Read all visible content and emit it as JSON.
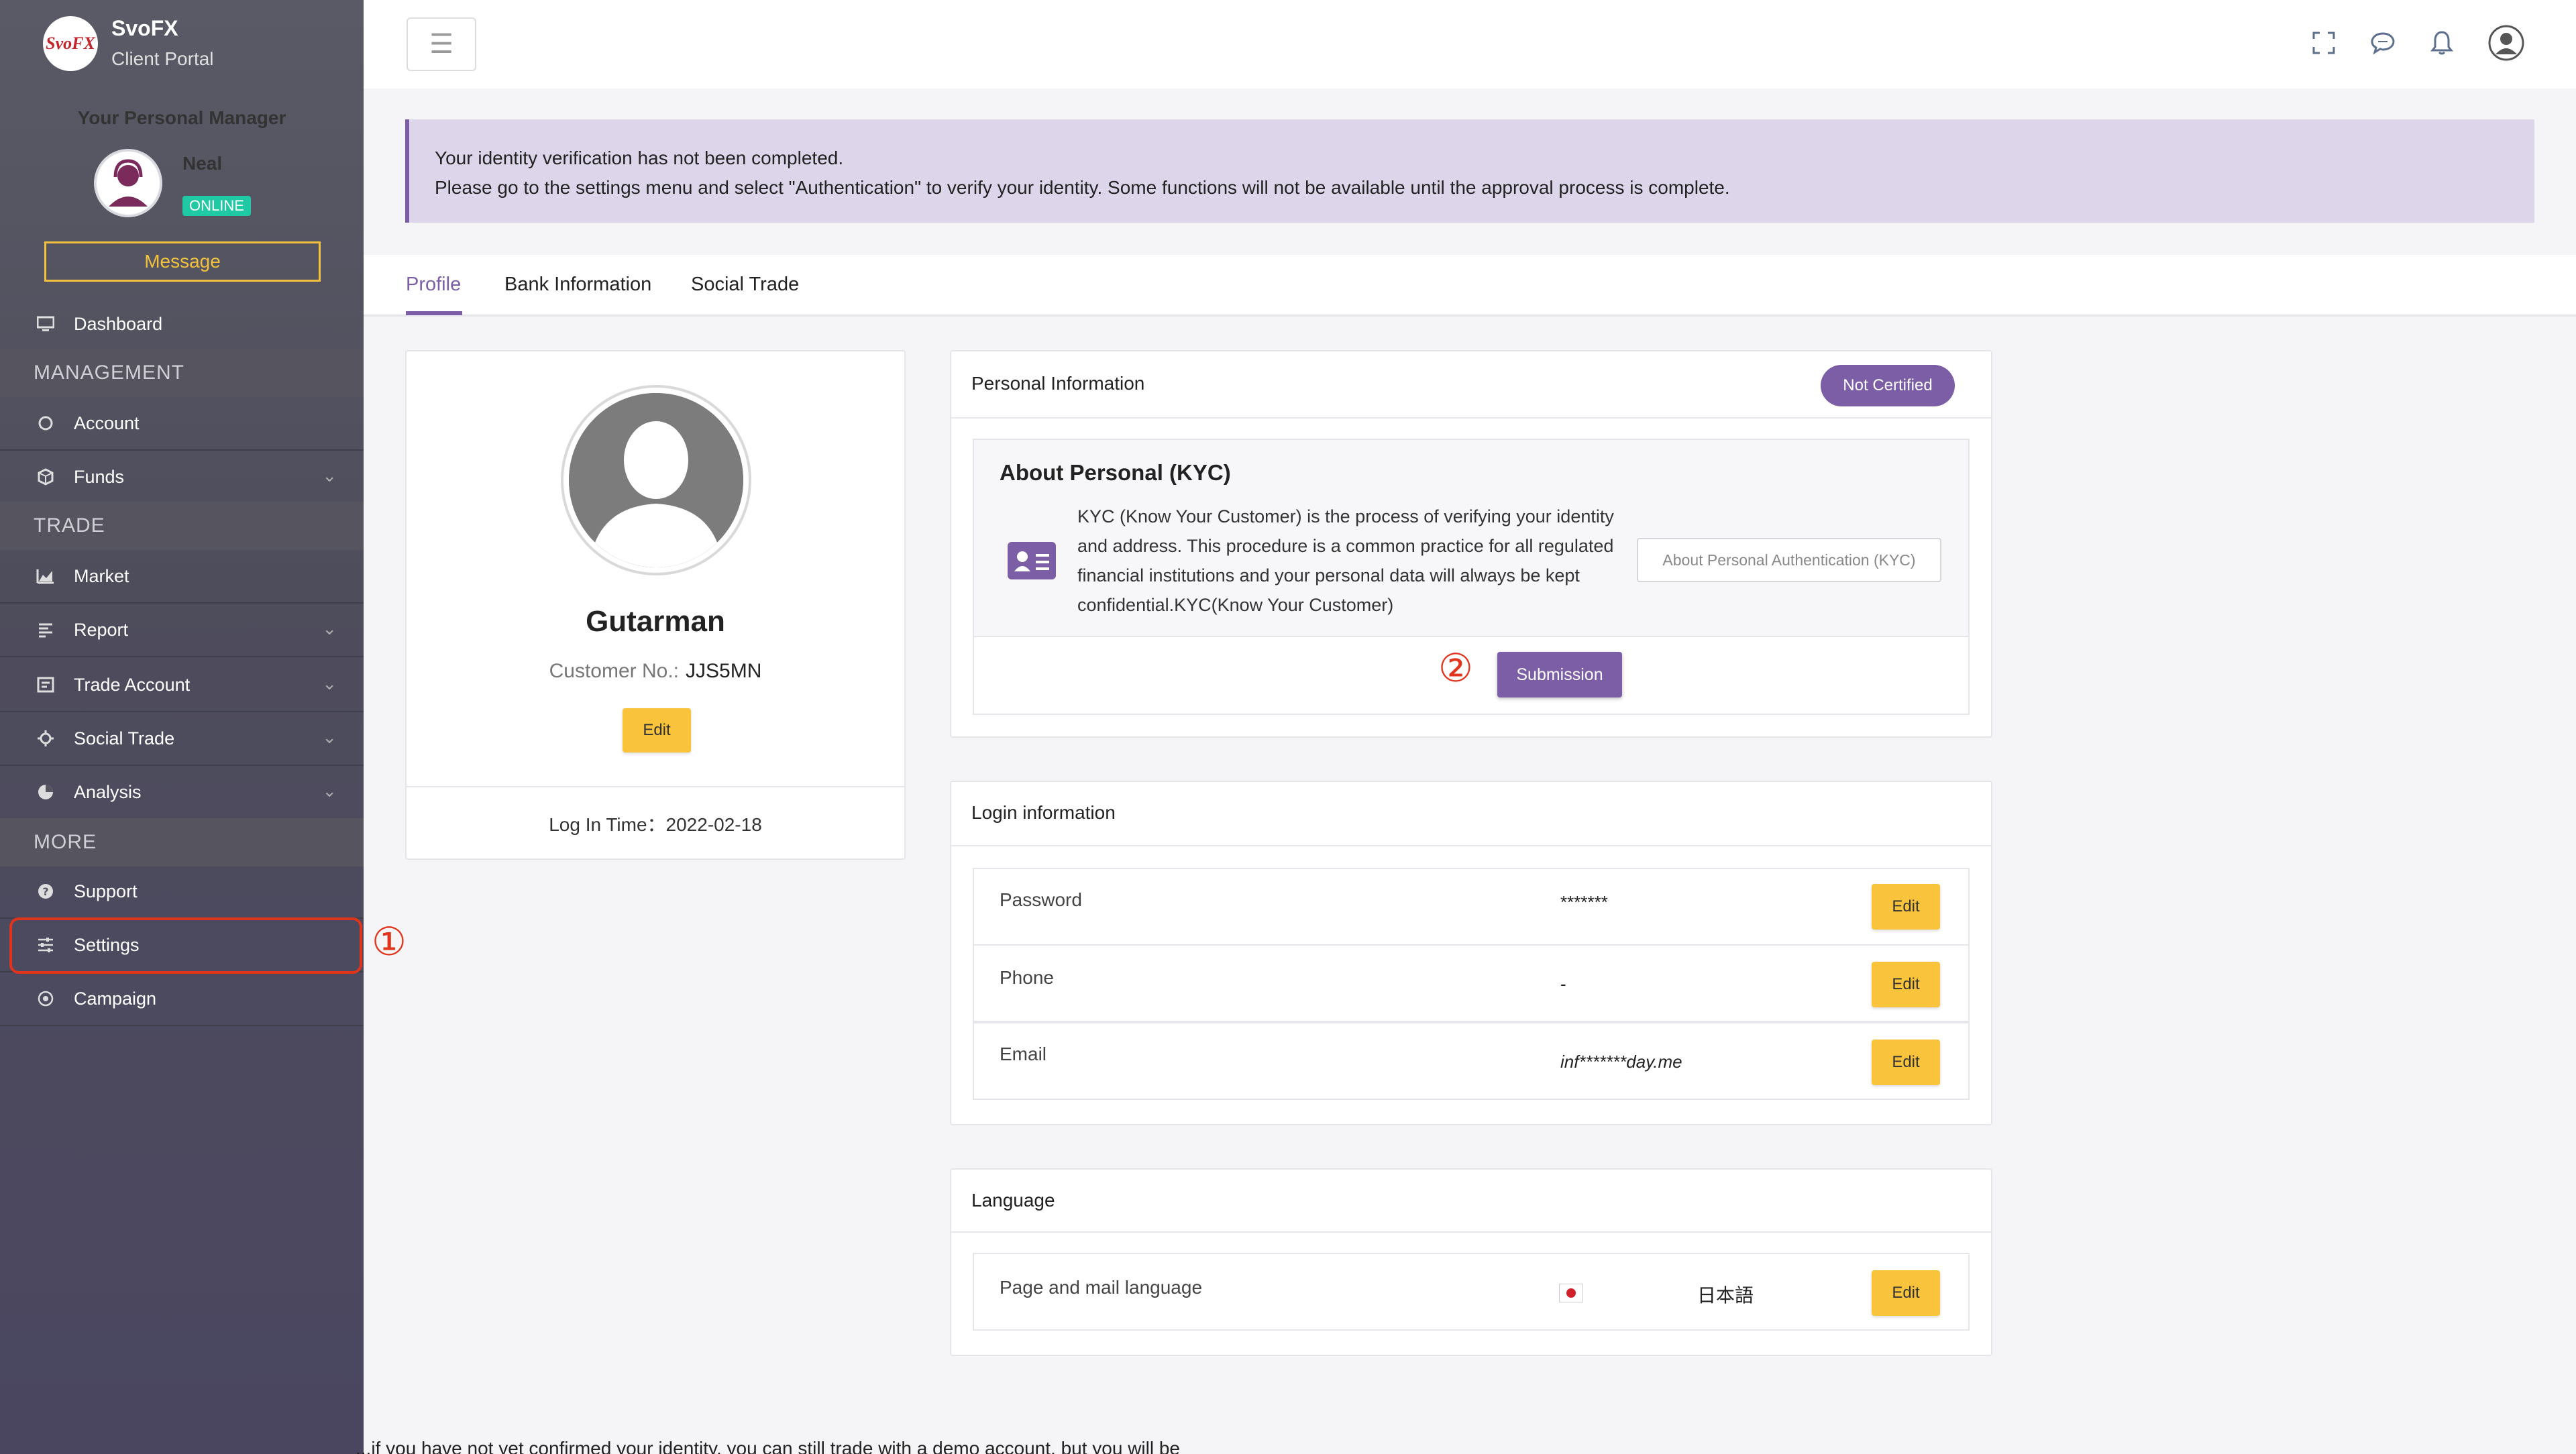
{
  "brand": {
    "logo_text": "SvoFX",
    "name": "SvoFX",
    "subtitle": "Client Portal"
  },
  "manager": {
    "title": "Your Personal Manager",
    "name": "Neal",
    "status": "ONLINE",
    "message_label": "Message"
  },
  "sidebar": {
    "dashboard": "Dashboard",
    "section_management": "MANAGEMENT",
    "account": "Account",
    "funds": "Funds",
    "section_trade": "TRADE",
    "market": "Market",
    "report": "Report",
    "trade_account": "Trade Account",
    "social_trade": "Social Trade",
    "analysis": "Analysis",
    "section_more": "MORE",
    "support": "Support",
    "settings": "Settings",
    "campaign": "Campaign"
  },
  "annotations": {
    "step1": "①",
    "step2": "②"
  },
  "alert": {
    "line1": "Your identity verification has not been completed.",
    "line2": "Please go to the settings menu and select \"Authentication\" to verify your identity. Some functions will not be available until the approval process is complete."
  },
  "tabs": {
    "profile": "Profile",
    "bank": "Bank Information",
    "social": "Social Trade"
  },
  "profile": {
    "name": "Gutarman",
    "customer_no_label": "Customer No.:",
    "customer_no": "JJS5MN",
    "edit_label": "Edit",
    "login_time": "Log In Time：2022-02-18"
  },
  "personal_info": {
    "title": "Personal Information",
    "badge": "Not Certified",
    "kyc_title": "About Personal (KYC)",
    "kyc_text": "KYC (Know Your Customer) is the process of verifying your identity and address. This procedure is a common practice for all regulated financial institutions and your personal data will always be kept confidential.KYC(Know Your Customer)",
    "kyc_link": "About Personal Authentication (KYC)",
    "submit_label": "Submission"
  },
  "login_info": {
    "title": "Login information",
    "rows": [
      {
        "label": "Password",
        "value": "*******",
        "edit": "Edit"
      },
      {
        "label": "Phone",
        "value": "-",
        "edit": "Edit"
      },
      {
        "label": "Email",
        "value": "inf*******day.me",
        "edit": "Edit"
      }
    ]
  },
  "language": {
    "title": "Language",
    "label": "Page and mail language",
    "value": "日本語",
    "edit": "Edit"
  },
  "footer_cut_text": "...if you have not yet confirmed your identity, you can still trade with a demo account, but you will be",
  "colors": {
    "accent": "#7b5ea6",
    "edit_button": "#f9c43b",
    "online": "#1fc9a4",
    "highlight": "#e0351c"
  }
}
